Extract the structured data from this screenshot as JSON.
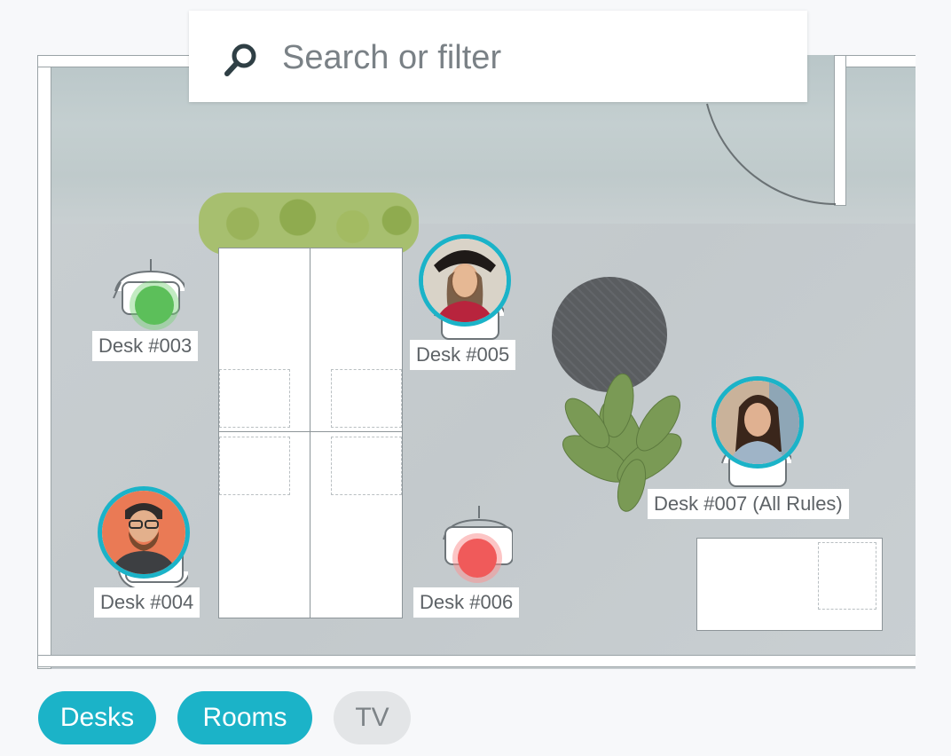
{
  "search": {
    "placeholder": "Search or filter"
  },
  "desks": [
    {
      "label": "Desk #003",
      "status": "available",
      "status_color": "#5cbf5a"
    },
    {
      "label": "Desk #004",
      "status": "booked"
    },
    {
      "label": "Desk #005",
      "status": "booked"
    },
    {
      "label": "Desk #006",
      "status": "unavailable",
      "status_color": "#f05a5a"
    },
    {
      "label": "Desk #007 (All Rules)",
      "status": "booked"
    }
  ],
  "filters": [
    {
      "label": "Desks",
      "active": true
    },
    {
      "label": "Rooms",
      "active": true
    },
    {
      "label": "TV",
      "active": false
    }
  ],
  "colors": {
    "accent": "#1bb3c8",
    "available": "#5cbf5a",
    "unavailable": "#f05a5a",
    "inactive_chip": "#e3e5e7"
  }
}
